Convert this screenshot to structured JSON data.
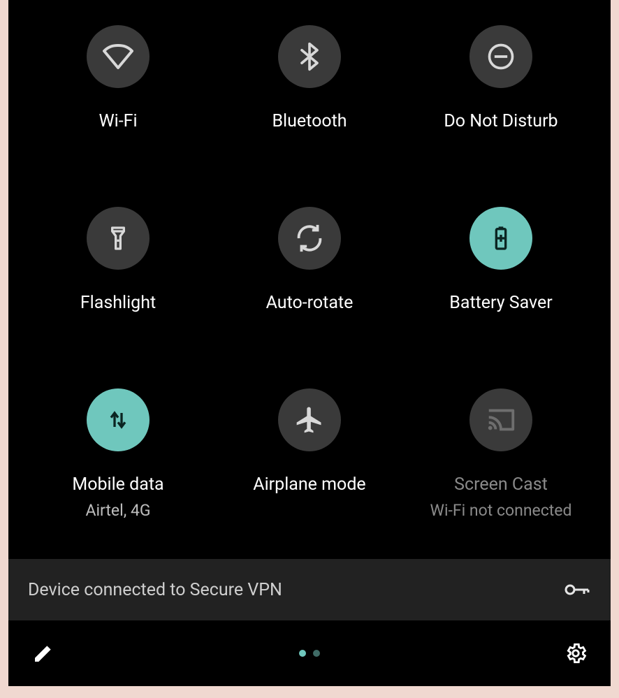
{
  "tiles": [
    {
      "icon": "wifi",
      "label": "Wi-Fi",
      "sub": "",
      "active": false,
      "disabled": false
    },
    {
      "icon": "bluetooth",
      "label": "Bluetooth",
      "sub": "",
      "active": false,
      "disabled": false
    },
    {
      "icon": "dnd",
      "label": "Do Not Disturb",
      "sub": "",
      "active": false,
      "disabled": false
    },
    {
      "icon": "flashlight",
      "label": "Flashlight",
      "sub": "",
      "active": false,
      "disabled": false
    },
    {
      "icon": "autorotate",
      "label": "Auto-rotate",
      "sub": "",
      "active": false,
      "disabled": false
    },
    {
      "icon": "battery",
      "label": "Battery Saver",
      "sub": "",
      "active": true,
      "disabled": false
    },
    {
      "icon": "mobiledata",
      "label": "Mobile data",
      "sub": "Airtel, 4G",
      "active": true,
      "disabled": false
    },
    {
      "icon": "airplane",
      "label": "Airplane mode",
      "sub": "",
      "active": false,
      "disabled": false
    },
    {
      "icon": "cast",
      "label": "Screen Cast",
      "sub": "Wi-Fi not connected",
      "active": false,
      "disabled": true
    }
  ],
  "notification": {
    "text": "Device connected to Secure VPN"
  },
  "pager": {
    "pages": 2,
    "current": 0
  },
  "colors": {
    "accent": "#6fc7bd",
    "tileOff": "#3a3a3a",
    "iconOff": "#d8d8d8",
    "iconOn": "#0b2522"
  }
}
